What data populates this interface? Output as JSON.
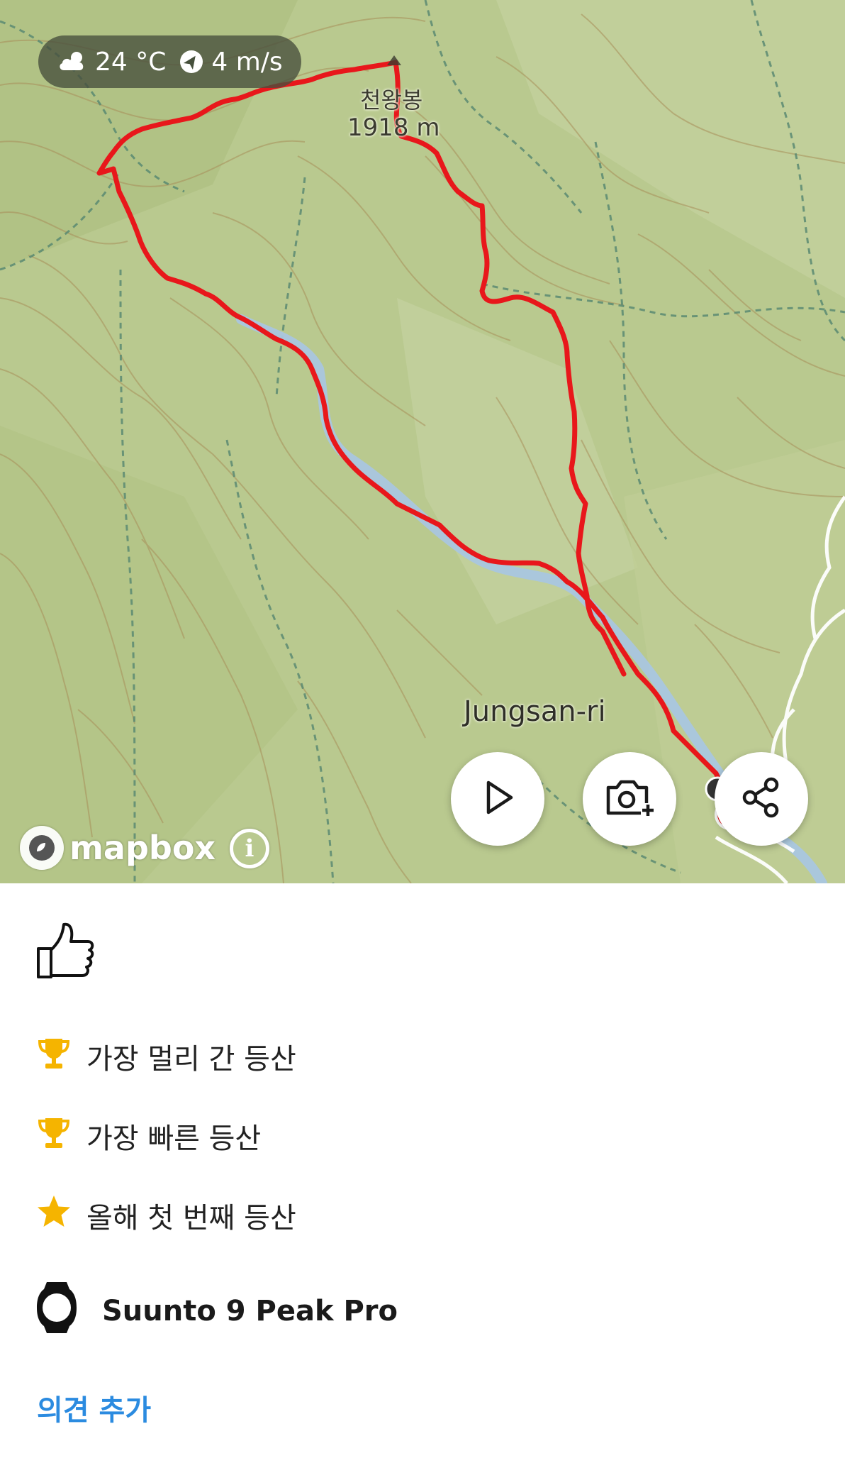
{
  "weather": {
    "temperature": "24 °C",
    "wind": "4 m/s",
    "weather_icon": "partly-cloudy-icon",
    "wind_icon": "wind-direction-icon"
  },
  "map": {
    "peak_name": "천왕봉",
    "peak_elevation": "1918 m",
    "village_name": "Jungsan-ri",
    "attribution": "mapbox",
    "info_glyph": "i",
    "route_color": "#e8171b",
    "terrain_color": "#b9c98f",
    "stream_color": "#a9c6df"
  },
  "actions": {
    "play_icon": "play-icon",
    "add_photo_icon": "camera-add-icon",
    "share_icon": "share-icon"
  },
  "achievements": [
    {
      "icon": "trophy-icon",
      "text": "가장 멀리 간 등산"
    },
    {
      "icon": "trophy-icon",
      "text": "가장 빠른 등산"
    },
    {
      "icon": "star-icon",
      "text": "올해 첫 번째 등산"
    }
  ],
  "device": {
    "name": "Suunto 9 Peak Pro",
    "icon": "watch-icon"
  },
  "comment": {
    "label": "의견 추가"
  },
  "colors": {
    "accent": "#2b8be0",
    "gold": "#f5b400"
  }
}
